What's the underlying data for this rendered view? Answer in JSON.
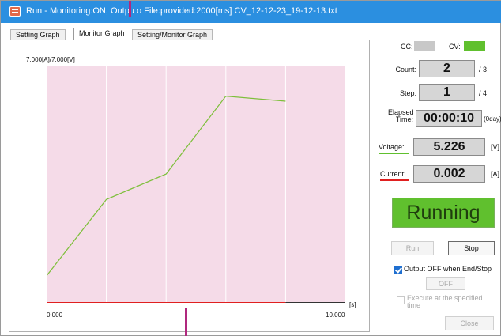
{
  "window": {
    "title": "Run - Monitoring:ON, Outpu  o File:provided:2000[ms] CV_12-12-23_19-12-13.txt",
    "icon": "app-window-icon"
  },
  "tabs": [
    {
      "label": "Setting Graph",
      "active": false
    },
    {
      "label": "Monitor Graph",
      "active": true
    },
    {
      "label": "Setting/Monitor Graph",
      "active": false
    }
  ],
  "graph": {
    "y_label": "7.000[A]/7.000[V]",
    "x_start": "0.000",
    "x_end": "10.000",
    "x_unit": "[s]"
  },
  "chart_data": {
    "type": "line",
    "title": "",
    "ylabel": "7.000[A]/7.000[V]",
    "xlabel": "[s]",
    "xlim": [
      0,
      10
    ],
    "ylim": [
      0,
      7
    ],
    "grid": true,
    "series": [
      {
        "color": "#7dbf3a",
        "x": [
          0,
          2,
          4,
          6,
          8
        ],
        "y": [
          0.8,
          3.05,
          3.8,
          6.1,
          5.95
        ]
      },
      {
        "color": "#e02020",
        "x": [
          0,
          8
        ],
        "y": [
          0,
          0
        ]
      }
    ]
  },
  "status": {
    "cc_label": "CC:",
    "cv_label": "CV:",
    "cc_color": "#c8c8c8",
    "cv_color": "#60c02e"
  },
  "count": {
    "label": "Count:",
    "value": "2",
    "suffix": "/ 3"
  },
  "step": {
    "label": "Step:",
    "value": "1",
    "suffix": "/ 4"
  },
  "elapsed": {
    "label_line1": "Elapsed",
    "label_line2": "Time:",
    "value": "00:00:10",
    "suffix": "(0day)"
  },
  "voltage": {
    "label": "Voltage:",
    "value": "5.226",
    "unit": "[V]",
    "underline_color": "#60c02e"
  },
  "current": {
    "label": "Current:",
    "value": "0.002",
    "unit": "[A]",
    "underline_color": "#e02020"
  },
  "state": {
    "text": "Running",
    "color": "#60c02e"
  },
  "buttons": {
    "run": "Run",
    "stop": "Stop",
    "off": "OFF",
    "close": "Close"
  },
  "options": {
    "output_off_label": "Output OFF when End/Stop",
    "output_off_checked": true,
    "execute_label_line1": "Execute at the specified",
    "execute_label_line2": "time",
    "execute_checked": false
  }
}
